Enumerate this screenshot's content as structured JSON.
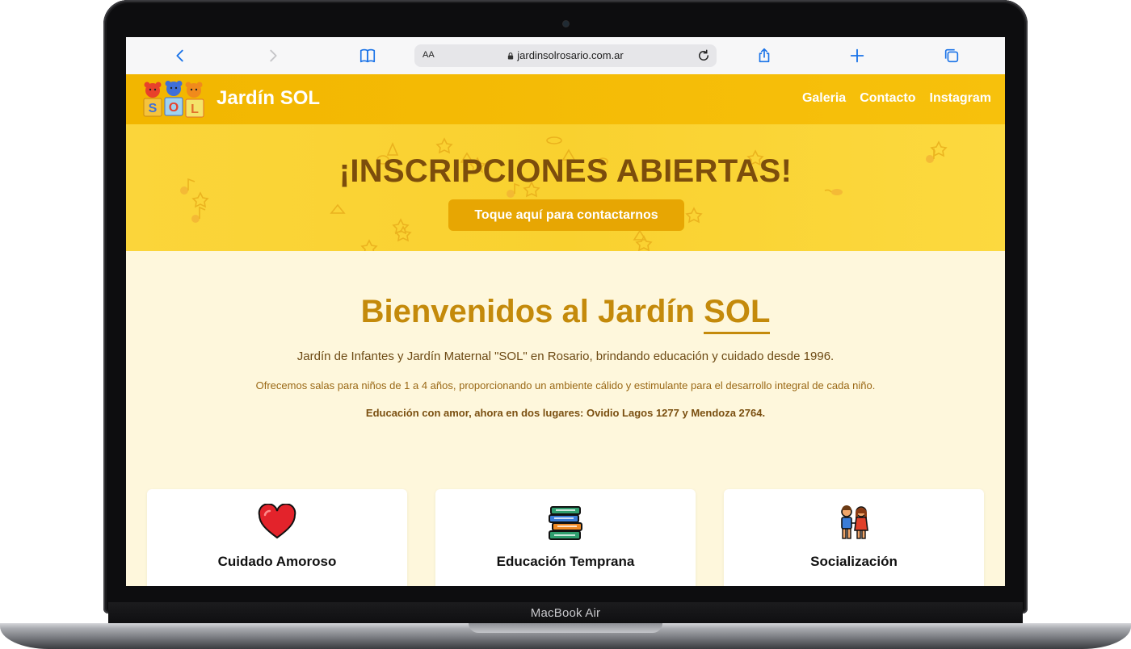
{
  "device": {
    "label": "MacBook Air"
  },
  "browser": {
    "address_text_size": "AA",
    "url": "jardinsolrosario.com.ar",
    "icons": [
      "back-icon",
      "forward-icon",
      "bookmarks-icon",
      "lock-icon",
      "reload-icon",
      "share-icon",
      "new-tab-icon",
      "tabs-icon"
    ]
  },
  "site": {
    "brand": "Jardín SOL",
    "logo_letters": [
      "S",
      "O",
      "L"
    ],
    "nav": [
      {
        "label": "Galeria"
      },
      {
        "label": "Contacto"
      },
      {
        "label": "Instagram"
      }
    ],
    "banner": {
      "title": "¡INSCRIPCIONES ABIERTAS!",
      "button": "Toque aquí para contactarnos"
    },
    "welcome": {
      "title_main": "Bienvenidos al Jardín",
      "title_accent": "SOL",
      "p1": "Jardín de Infantes y Jardín Maternal \"SOL\" en Rosario, brindando educación y cuidado desde 1996.",
      "p2": "Ofrecemos salas para niños de 1 a 4 años, proporcionando un ambiente cálido y estimulante para el desarrollo integral de cada niño.",
      "p3": "Educación con amor, ahora en dos lugares: Ovidio Lagos 1277 y Mendoza 2764."
    },
    "cards": [
      {
        "title": "Cuidado Amoroso",
        "icon": "heart-icon"
      },
      {
        "title": "Educación Temprana",
        "icon": "books-icon"
      },
      {
        "title": "Socialización",
        "icon": "children-icon"
      }
    ]
  },
  "colors": {
    "header": "#f2b600",
    "banner": "#fbd53a",
    "banner_title": "#7c4d0c",
    "button": "#e7a603",
    "accent_title": "#c48a0b",
    "page_bg": "#fef7dc"
  }
}
